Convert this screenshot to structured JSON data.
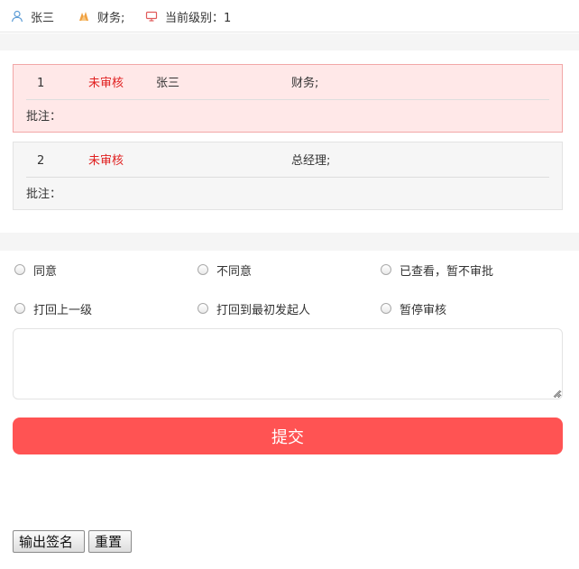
{
  "header": {
    "user": "张三",
    "department": "财务;",
    "level_label": "当前级别：1"
  },
  "records": [
    {
      "no": "1",
      "status": "未审核",
      "name": "张三",
      "role": "财务;",
      "note_label": "批注："
    },
    {
      "no": "2",
      "status": "未审核",
      "name": "",
      "role": "总经理;",
      "note_label": "批注："
    }
  ],
  "options": {
    "agree": "同意",
    "disagree": "不同意",
    "viewed": "已查看，暂不审批",
    "back_prev": "打回上一级",
    "back_origin": "打回到最初发起人",
    "pause": "暂停审核"
  },
  "remark": {
    "value": "",
    "placeholder": ""
  },
  "actions": {
    "submit": "提交",
    "output_sign": "输出签名",
    "reset": "重置"
  },
  "colors": {
    "accent": "#ff5353",
    "status_pending": "#e02020",
    "active_card_bg": "#ffe8e8"
  }
}
